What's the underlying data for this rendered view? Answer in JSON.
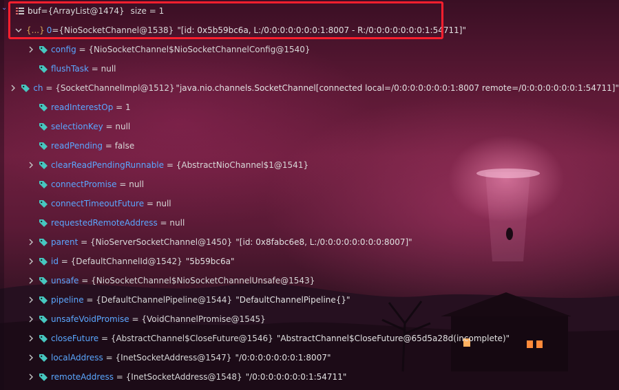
{
  "root": {
    "name": "buf",
    "equals": " = ",
    "value": "{ArrayList@1474}",
    "size_label": "size = 1"
  },
  "element0": {
    "badge": "{...}",
    "index": "0",
    "equals": " = ",
    "value": "{NioSocketChannel@1538}",
    "string": "\"[id: 0x5b59bc6a, L:/0:0:0:0:0:0:0:1:8007 - R:/0:0:0:0:0:0:0:1:54711]\""
  },
  "fields": [
    {
      "name": "config",
      "value": "{NioSocketChannel$NioSocketChannelConfig@1540}",
      "str": "",
      "expandable": true
    },
    {
      "name": "flushTask",
      "value": "null",
      "str": "",
      "expandable": false
    },
    {
      "name": "ch",
      "value": "{SocketChannelImpl@1512}",
      "str": "\"java.nio.channels.SocketChannel[connected local=/0:0:0:0:0:0:0:1:8007 remote=/0:0:0:0:0:0:0:1:54711]\"",
      "expandable": true
    },
    {
      "name": "readInterestOp",
      "value": "1",
      "str": "",
      "expandable": false
    },
    {
      "name": "selectionKey",
      "value": "null",
      "str": "",
      "expandable": false
    },
    {
      "name": "readPending",
      "value": "false",
      "str": "",
      "expandable": false
    },
    {
      "name": "clearReadPendingRunnable",
      "value": "{AbstractNioChannel$1@1541}",
      "str": "",
      "expandable": true
    },
    {
      "name": "connectPromise",
      "value": "null",
      "str": "",
      "expandable": false
    },
    {
      "name": "connectTimeoutFuture",
      "value": "null",
      "str": "",
      "expandable": false
    },
    {
      "name": "requestedRemoteAddress",
      "value": "null",
      "str": "",
      "expandable": false
    },
    {
      "name": "parent",
      "value": "{NioServerSocketChannel@1450}",
      "str": "\"[id: 0x8fabc6e8, L:/0:0:0:0:0:0:0:0:8007]\"",
      "expandable": true
    },
    {
      "name": "id",
      "value": "{DefaultChannelId@1542}",
      "str": "\"5b59bc6a\"",
      "expandable": true
    },
    {
      "name": "unsafe",
      "value": "{NioSocketChannel$NioSocketChannelUnsafe@1543}",
      "str": "",
      "expandable": true
    },
    {
      "name": "pipeline",
      "value": "{DefaultChannelPipeline@1544}",
      "str": "\"DefaultChannelPipeline{}\"",
      "expandable": true
    },
    {
      "name": "unsafeVoidPromise",
      "value": "{VoidChannelPromise@1545}",
      "str": "",
      "expandable": true
    },
    {
      "name": "closeFuture",
      "value": "{AbstractChannel$CloseFuture@1546}",
      "str": "\"AbstractChannel$CloseFuture@65d5a28d(incomplete)\"",
      "expandable": true
    },
    {
      "name": "localAddress",
      "value": "{InetSocketAddress@1547}",
      "str": "\"/0:0:0:0:0:0:0:1:8007\"",
      "expandable": true
    },
    {
      "name": "remoteAddress",
      "value": "{InetSocketAddress@1548}",
      "str": "\"/0:0:0:0:0:0:0:1:54711\"",
      "expandable": true
    }
  ],
  "icons": {
    "root": "list-icon",
    "field": "field-tag-icon",
    "expander": "chevron-right-icon",
    "collapser": "chevron-down-icon"
  },
  "colors": {
    "field_name": "#5aa7ff",
    "highlight_border": "#ff1f2e",
    "field_icon": "#47c7c0"
  }
}
